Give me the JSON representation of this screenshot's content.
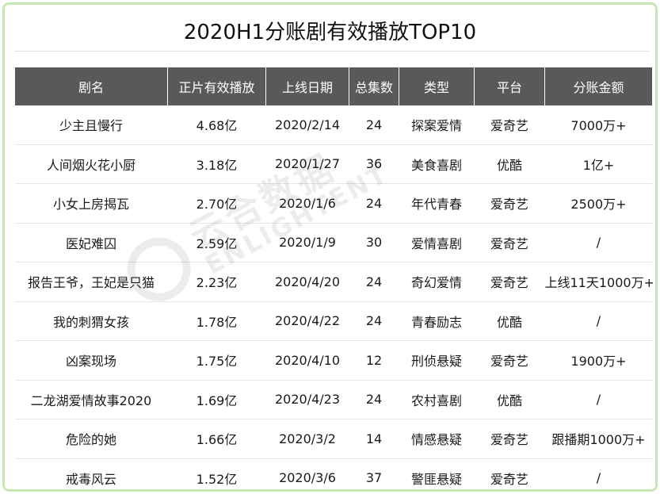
{
  "title": "2020H1分账剧有效播放TOP10",
  "table": {
    "columns": [
      "剧名",
      "正片有效播放",
      "上线日期",
      "总集数",
      "类型",
      "平台",
      "分账金额"
    ],
    "rows": [
      [
        "少主且慢行",
        "4.68亿",
        "2020/2/14",
        "24",
        "探案爱情",
        "爱奇艺",
        "7000万+"
      ],
      [
        "人间烟火花小厨",
        "3.18亿",
        "2020/1/27",
        "36",
        "美食喜剧",
        "优酷",
        "1亿+"
      ],
      [
        "小女上房揭瓦",
        "2.70亿",
        "2020/1/6",
        "24",
        "年代青春",
        "爱奇艺",
        "2500万+"
      ],
      [
        "医妃难囚",
        "2.59亿",
        "2020/1/9",
        "30",
        "爱情喜剧",
        "爱奇艺",
        "/"
      ],
      [
        "报告王爷，王妃是只猫",
        "2.23亿",
        "2020/4/20",
        "24",
        "奇幻爱情",
        "爱奇艺",
        "上线11天1000万+"
      ],
      [
        "我的刺猬女孩",
        "1.78亿",
        "2020/4/22",
        "24",
        "青春励志",
        "优酷",
        "/"
      ],
      [
        "凶案现场",
        "1.75亿",
        "2020/4/10",
        "12",
        "刑侦悬疑",
        "爱奇艺",
        "1900万+"
      ],
      [
        "二龙湖爱情故事2020",
        "1.69亿",
        "2020/4/23",
        "24",
        "农村喜剧",
        "优酷",
        "/"
      ],
      [
        "危险的她",
        "1.66亿",
        "2020/3/2",
        "14",
        "情感悬疑",
        "爱奇艺",
        "跟播期1000万+"
      ],
      [
        "戒毒风云",
        "1.52亿",
        "2020/3/6",
        "37",
        "警匪悬疑",
        "爱奇艺",
        "/"
      ]
    ]
  },
  "watermark": {
    "text_cn": "云合数据",
    "text_en": "ENLIGHTENT"
  },
  "colors": {
    "frame_border": "#c7e7b2",
    "header_bg": "#595959",
    "header_text": "#ffffff",
    "row_divider": "#e6e6e6"
  }
}
